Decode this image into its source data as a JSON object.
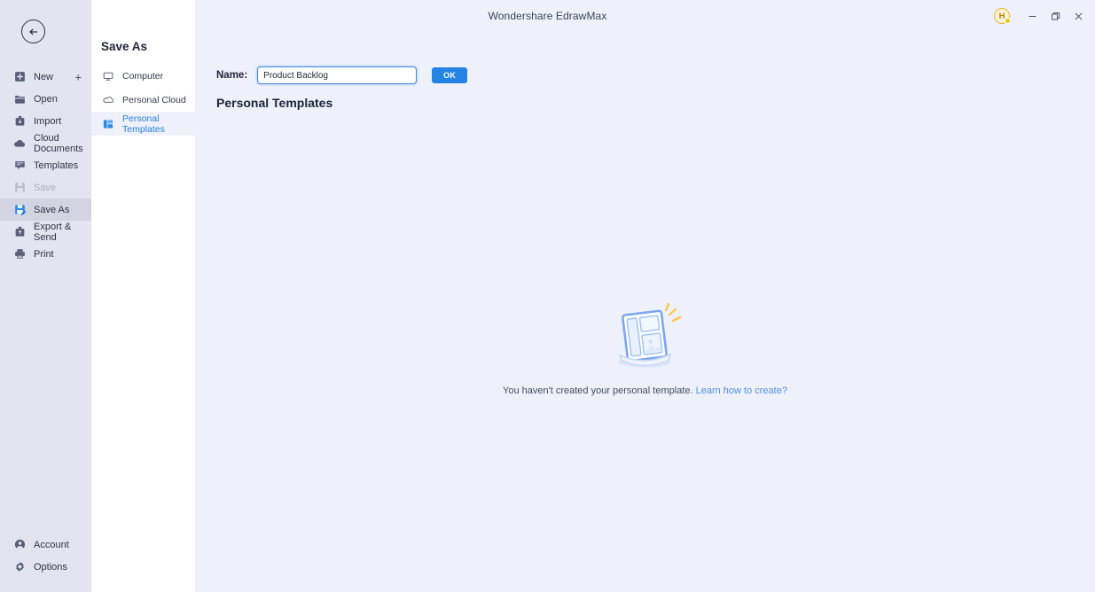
{
  "window": {
    "title": "Wondershare EdrawMax",
    "avatar_initial": "H",
    "minimize_label": "─",
    "maximize_label": "❐",
    "close_label": "✕"
  },
  "toolbar": {
    "items": [
      {
        "name": "help-icon",
        "label": ""
      },
      {
        "name": "notification-icon",
        "label": ""
      },
      {
        "name": "apps-grid-icon",
        "label": ""
      },
      {
        "name": "theme-icon",
        "label": ""
      },
      {
        "name": "settings-gear-icon",
        "label": ""
      }
    ]
  },
  "sidebar": {
    "back_label": "←",
    "items": [
      {
        "label": "New",
        "icon": "new-icon",
        "selected": false,
        "disabled": false,
        "has_plus": true
      },
      {
        "label": "Open",
        "icon": "folder-icon",
        "selected": false,
        "disabled": false,
        "has_plus": false
      },
      {
        "label": "Import",
        "icon": "import-icon",
        "selected": false,
        "disabled": false,
        "has_plus": false
      },
      {
        "label": "Cloud Documents",
        "icon": "cloud-icon",
        "selected": false,
        "disabled": false,
        "has_plus": false
      },
      {
        "label": "Templates",
        "icon": "templates-icon",
        "selected": false,
        "disabled": false,
        "has_plus": false
      },
      {
        "label": "Save",
        "icon": "save-icon",
        "selected": false,
        "disabled": true,
        "has_plus": false
      },
      {
        "label": "Save As",
        "icon": "save-as-icon",
        "selected": true,
        "disabled": false,
        "has_plus": false
      },
      {
        "label": "Export & Send",
        "icon": "export-send-icon",
        "selected": false,
        "disabled": false,
        "has_plus": false
      },
      {
        "label": "Print",
        "icon": "printer-icon",
        "selected": false,
        "disabled": false,
        "has_plus": false
      }
    ],
    "bottom_items": [
      {
        "label": "Account",
        "icon": "account-icon"
      },
      {
        "label": "Options",
        "icon": "options-gear-icon"
      }
    ]
  },
  "mid_panel": {
    "title": "Save As",
    "items": [
      {
        "label": "Computer",
        "icon": "monitor-icon",
        "selected": false
      },
      {
        "label": "Personal Cloud",
        "icon": "cloud-outline-icon",
        "selected": false
      },
      {
        "label": "Personal Templates",
        "icon": "personal-templates-icon",
        "selected": true
      }
    ]
  },
  "content": {
    "name_label": "Name:",
    "name_value": "Product Backlog",
    "name_placeholder": "",
    "ok_label": "OK",
    "section_title": "Personal Templates",
    "empty_message": "You haven't created your personal template.",
    "empty_link": "Learn how to create?"
  },
  "colors": {
    "accent_blue": "#2483e3",
    "link_blue": "#4a90e8",
    "sidebar_bg": "#e2e4f0",
    "panel_bg": "#ffffff",
    "content_bg": "#eef1fa",
    "avatar_gold": "#e7b830",
    "notice_red": "#ef4135"
  }
}
